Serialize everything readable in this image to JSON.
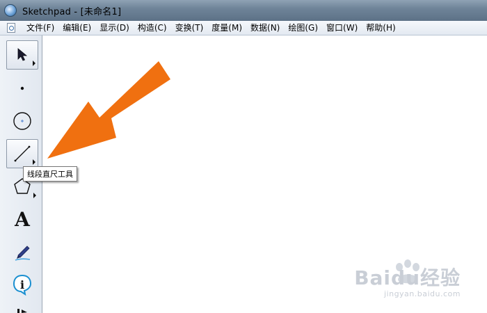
{
  "window": {
    "title": "Sketchpad  - [未命名1]",
    "app_icon": "sketchpad-globe-icon"
  },
  "menu": {
    "items": [
      {
        "label": "文件(F)"
      },
      {
        "label": "编辑(E)"
      },
      {
        "label": "显示(D)"
      },
      {
        "label": "构造(C)"
      },
      {
        "label": "变换(T)"
      },
      {
        "label": "度量(M)"
      },
      {
        "label": "数据(N)"
      },
      {
        "label": "绘图(G)"
      },
      {
        "label": "窗口(W)"
      },
      {
        "label": "帮助(H)"
      }
    ]
  },
  "toolbox": {
    "tools": [
      {
        "name": "arrow-select-tool",
        "icon": "pointer-arrow-icon",
        "selected": true
      },
      {
        "name": "point-tool",
        "icon": "point-icon"
      },
      {
        "name": "compass-tool",
        "icon": "circle-icon"
      },
      {
        "name": "straightedge-tool",
        "icon": "line-segment-icon",
        "hover": true
      },
      {
        "name": "polygon-tool",
        "icon": "pentagon-icon"
      },
      {
        "name": "text-tool",
        "icon": "text-A-icon",
        "glyph": "A"
      },
      {
        "name": "marker-tool",
        "icon": "marker-pen-icon"
      },
      {
        "name": "information-tool",
        "icon": "info-icon",
        "glyph": "i"
      }
    ]
  },
  "tooltip": {
    "text": "线段直尺工具"
  },
  "overlay": {
    "arrow_color": "#f07010"
  },
  "watermark": {
    "brand": "Baidu经验",
    "url": "jingyan.baidu.com"
  }
}
